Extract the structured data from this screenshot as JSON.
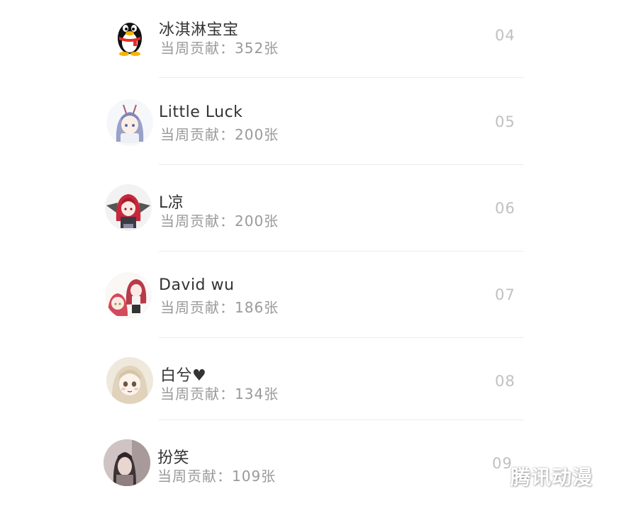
{
  "ranking": {
    "contribution_prefix": "当周贡献：",
    "rows": [
      {
        "name": "冰淇淋宝宝",
        "contribution": "当周贡献：352张",
        "rank": "04",
        "avatar_icon": "penguin-avatar-icon"
      },
      {
        "name": "Little  Luck",
        "contribution": "当周贡献：200张",
        "rank": "05",
        "avatar_icon": "anime-girl-avatar-icon"
      },
      {
        "name": "L凉",
        "contribution": "当周贡献：200张",
        "rank": "06",
        "avatar_icon": "anime-girl-avatar-icon"
      },
      {
        "name": "David wu",
        "contribution": "当周贡献：186张",
        "rank": "07",
        "avatar_icon": "anime-girl-avatar-icon"
      },
      {
        "name": "白兮♥",
        "contribution": "当周贡献：134张",
        "rank": "08",
        "avatar_icon": "anime-girl-avatar-icon"
      },
      {
        "name": "扮笑",
        "contribution": "当周贡献：109张",
        "rank": "09",
        "avatar_icon": "photo-avatar-icon"
      }
    ]
  },
  "watermark": "腾讯动漫",
  "colors": {
    "name": "#333333",
    "contribution": "#9a9a9a",
    "rank": "#c0c0c0",
    "divider": "#ececec"
  }
}
